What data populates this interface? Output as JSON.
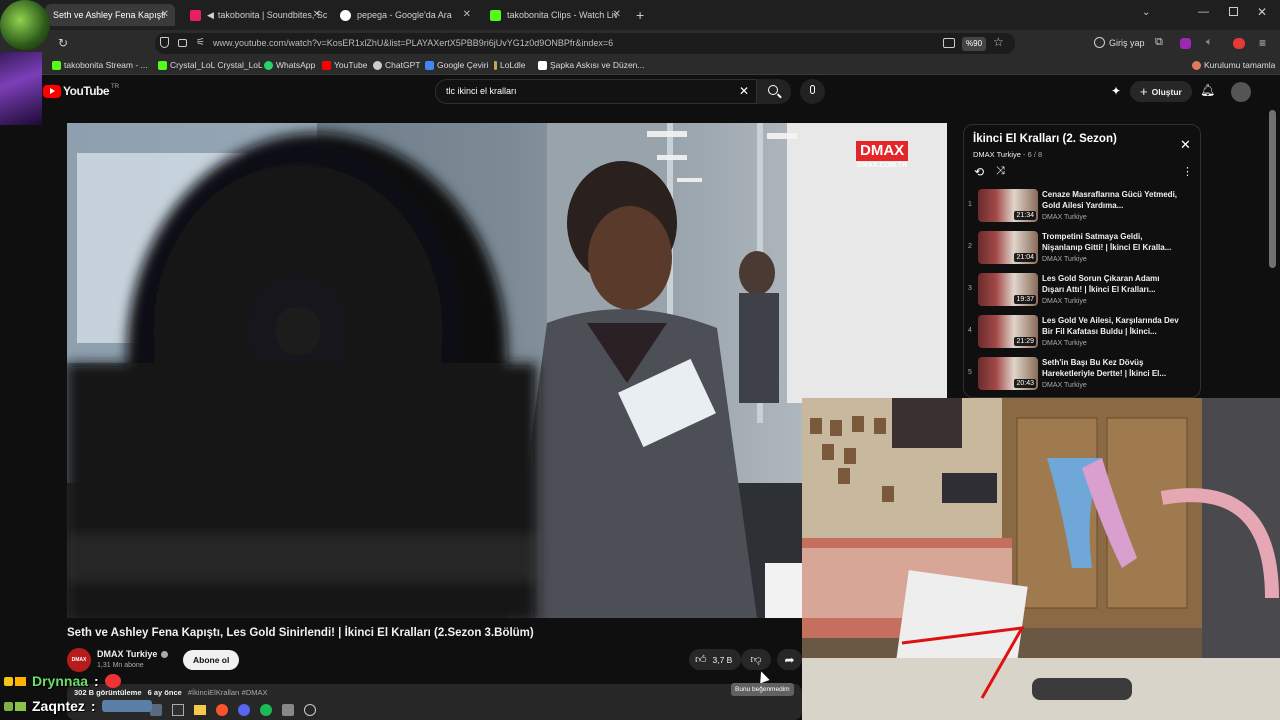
{
  "tabs": [
    {
      "title": "Seth ve Ashley Fena Kapıştı, Les",
      "active": true,
      "favicon_color": "#ff0000"
    },
    {
      "title": "takobonita | Soundbites, Sc",
      "active": false,
      "favicon_color": "#e91e63"
    },
    {
      "title": "pepega - Google'da Ara",
      "active": false,
      "favicon_color": "#4285f4"
    },
    {
      "title": "takobonita Clips - Watch Live o",
      "active": false,
      "favicon_color": "#53fc18"
    }
  ],
  "address": {
    "url": "www.youtube.com/watch?v=KosER1xlZhU&list=PLAYAXertX5PBB9ri6jUvYG1z0d9ONBPfr&index=6",
    "zoom": "%90",
    "profile": "Giriş yap"
  },
  "bookmarks": [
    {
      "label": "takobonita Stream - ...",
      "color": "#53fc18"
    },
    {
      "label": "Crystal_LoL  Crystal_LoL",
      "color": "#53fc18"
    },
    {
      "label": "WhatsApp",
      "color": "#25d366"
    },
    {
      "label": "YouTube",
      "color": "#ff0000"
    },
    {
      "label": "ChatGPT",
      "color": "#cccccc"
    },
    {
      "label": "Google Çeviri",
      "color": "#4285f4"
    },
    {
      "label": "LoLdle",
      "color": "#c8a35a"
    },
    {
      "label": "Şapka Askısı ve Düzen...",
      "color": "#ffffff"
    },
    {
      "label": "Kurulumu tamamla",
      "color": "#e07a5f"
    }
  ],
  "yt": {
    "logo": "YouTube",
    "country": "TR",
    "search_value": "tlc ikinci el kralları",
    "create_label": "Oluştur"
  },
  "video": {
    "watermark_top": "DMAX",
    "watermark_bottom": "DMAX.COM.TR",
    "title": "Seth ve Ashley Fena Kapıştı, Les Gold Sinirlendi! | İkinci El Kralları (2.Sezon 3.Bölüm)",
    "channel": "DMAX Turkiye",
    "subscribers": "1,31 Mn abone",
    "subscribe_label": "Abone ol",
    "likes": "3,7 B",
    "tooltip": "Bunu beğenmedim",
    "views": "302 B görüntüleme",
    "age": "6 ay önce",
    "tags": "#İkinciElKralları #DMAX"
  },
  "playlist": {
    "title": "İkinci El Kralları (2. Sezon)",
    "channel": "DMAX Turkiye",
    "position": "6 / 8",
    "items": [
      {
        "num": "1",
        "title": "Cenaze Masraflarına Gücü Yetmedi, Gold Ailesi Yardıma...",
        "channel": "DMAX Turkiye",
        "duration": "21:34"
      },
      {
        "num": "2",
        "title": "Trompetini Satmaya Geldi, Nişanlanıp Gitti! | İkinci El Kralla...",
        "channel": "DMAX Turkiye",
        "duration": "21:04"
      },
      {
        "num": "3",
        "title": "Les Gold Sorun Çıkaran Adamı Dışarı Attı! | İkinci El Kralları...",
        "channel": "DMAX Turkiye",
        "duration": "19:37"
      },
      {
        "num": "4",
        "title": "Les Gold Ve Ailesi, Karşılarında Dev Bir Fil Kafatası Buldu | İkinci...",
        "channel": "DMAX Turkiye",
        "duration": "21:29"
      },
      {
        "num": "5",
        "title": "Seth'in Başı Bu Kez Dövüş Hareketleriyle Dertte! | İkinci El...",
        "channel": "DMAX Turkiye",
        "duration": "20:43"
      }
    ]
  },
  "chat": [
    {
      "name": "Drynnaa",
      "sep": ":"
    },
    {
      "name": "Zaqntez",
      "sep": ":"
    }
  ]
}
